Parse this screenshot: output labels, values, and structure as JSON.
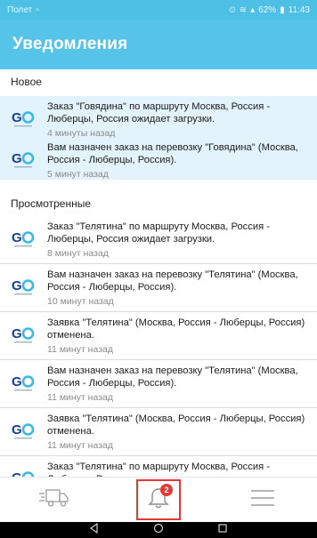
{
  "status_bar": {
    "carrier": "Полет",
    "battery": "62%",
    "time": "11:43"
  },
  "header": {
    "title": "Уведомления"
  },
  "sections": {
    "new_title": "Новое",
    "seen_title": "Просмотренные"
  },
  "new_items": [
    {
      "text": "Заказ \"Говядина\" по маршруту Москва, Россия - Люберцы, Россия ожидает загрузки.",
      "time": "4 минуты назад"
    },
    {
      "text": "Вам назначен заказ на перевозку \"Говядина\" (Москва, Россия - Люберцы, Россия).",
      "time": "5 минут назад"
    }
  ],
  "seen_items": [
    {
      "text": "Заказ \"Телятина\" по маршруту Москва, Россия - Люберцы, Россия ожидает загрузки.",
      "time": "8 минут назад"
    },
    {
      "text": "Вам назначен заказ на перевозку \"Телятина\" (Москва, Россия - Люберцы, Россия).",
      "time": "10 минут назад"
    },
    {
      "text": "Заявка \"Телятина\" (Москва, Россия - Люберцы, Россия) отменена.",
      "time": "11 минут назад"
    },
    {
      "text": "Вам назначен заказ на перевозку \"Телятина\" (Москва, Россия - Люберцы, Россия).",
      "time": "11 минут назад"
    },
    {
      "text": "Заявка \"Телятина\" (Москва, Россия - Люберцы, Россия) отменена.",
      "time": "11 минут назад"
    },
    {
      "text": "Заказ \"Телятина\" по маршруту Москва, Россия - Люберцы, Россия ожидает загрузки.",
      "time": ""
    }
  ],
  "bottom_nav": {
    "badge_count": "2",
    "items": [
      {
        "icon": "truck-icon"
      },
      {
        "icon": "bell-icon",
        "active": true
      },
      {
        "icon": "menu-icon"
      }
    ]
  },
  "colors": {
    "header": "#56c3e8",
    "status_bar": "#4ec0e6",
    "new_bg": "#e3f3fb",
    "badge": "#e53935",
    "logo_blue": "#1b3f8f",
    "logo_cyan": "#3ab7e4"
  }
}
